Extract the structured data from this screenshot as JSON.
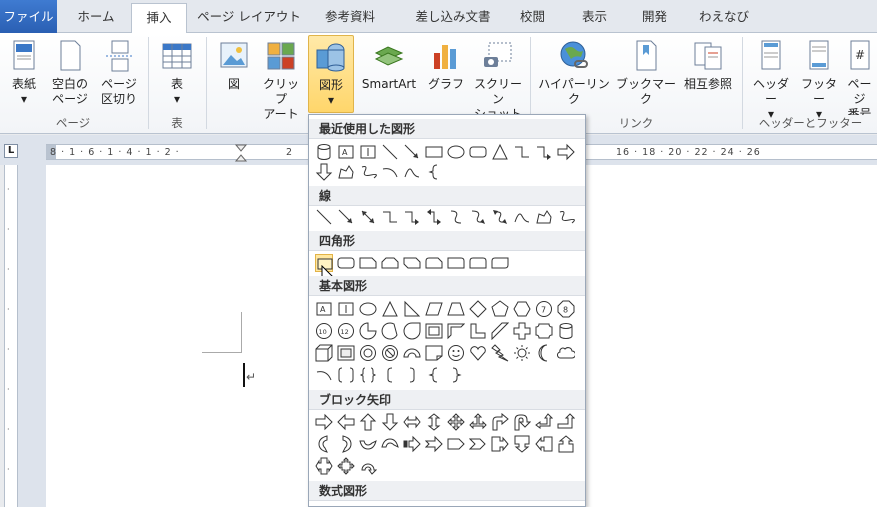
{
  "tabs": [
    {
      "label": "ファイル",
      "id": "file"
    },
    {
      "label": "ホーム",
      "id": "home"
    },
    {
      "label": "挿入",
      "id": "insert"
    },
    {
      "label": "ページ レイアウト",
      "id": "layout"
    },
    {
      "label": "参考資料",
      "id": "references"
    },
    {
      "label": "差し込み文書",
      "id": "mailings"
    },
    {
      "label": "校閲",
      "id": "review"
    },
    {
      "label": "表示",
      "id": "view"
    },
    {
      "label": "開発",
      "id": "developer"
    },
    {
      "label": "わえなび",
      "id": "waenavi"
    }
  ],
  "ribbon": {
    "cover": "表紙",
    "blank1": "空白の",
    "blank2": "ページ",
    "break1": "ページ",
    "break2": "区切り",
    "table": "表",
    "picture": "図",
    "clip1": "クリップ",
    "clip2": "アート",
    "shapes": "図形",
    "smartart": "SmartArt",
    "chart": "グラフ",
    "screen1": "スクリーン",
    "screen2": "ショット",
    "hyperlink": "ハイパーリンク",
    "bookmark": "ブックマーク",
    "crossref": "相互参照",
    "header": "ヘッダー",
    "footer": "フッター",
    "pagenum1": "ページ",
    "pagenum2": "番号",
    "grp_pages": "ページ",
    "grp_table": "表",
    "grp_links": "リンク",
    "grp_hf": "ヘッダーとフッター"
  },
  "ruler": {
    "corner": "L",
    "ticks_left": "8 · 1 · 6 · 1 · 4 · 1 · 2 ·",
    "tick_2": "2",
    "ticks_right": "16 · 18 · 20 · 22 · 24 · 26"
  },
  "shapes_menu": {
    "recent": "最近使用した図形",
    "lines": "線",
    "rectangles": "四角形",
    "basic": "基本図形",
    "block_arrows": "ブロック矢印",
    "equation": "数式図形"
  }
}
